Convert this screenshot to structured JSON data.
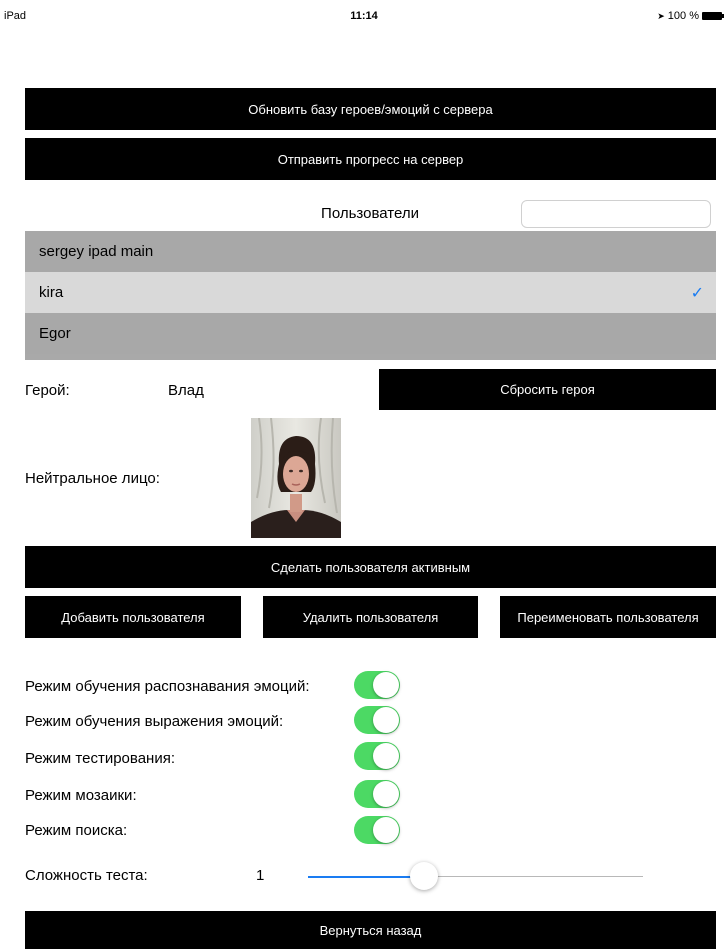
{
  "status_bar": {
    "carrier": "iPad",
    "time": "11:14",
    "location_icon": "location-arrow-icon",
    "battery_text": "100 %"
  },
  "buttons": {
    "update_db": "Обновить базу героев/эмоций с сервера",
    "send_progress": "Отправить прогресс на сервер",
    "reset_hero": "Сбросить героя",
    "make_active": "Сделать пользователя активным",
    "add_user": "Добавить пользователя",
    "delete_user": "Удалить пользователя",
    "rename_user": "Переименовать пользователя",
    "back": "Вернуться назад"
  },
  "users": {
    "title": "Пользователи",
    "search_value": "",
    "items": [
      {
        "name": "sergey ipad main",
        "selected": false
      },
      {
        "name": "kira",
        "selected": true
      },
      {
        "name": "Egor",
        "selected": false
      }
    ],
    "check_mark": "✓"
  },
  "hero": {
    "label": "Герой:",
    "value": "Влад"
  },
  "neutral_face": {
    "label": "Нейтральное лицо:"
  },
  "modes": [
    {
      "label": "Режим обучения распознавания эмоций:",
      "on": true
    },
    {
      "label": "Режим обучения выражения эмоций:",
      "on": true
    },
    {
      "label": "Режим тестирования:",
      "on": true
    },
    {
      "label": "Режим мозаики:",
      "on": true
    },
    {
      "label": "Режим поиска:",
      "on": true
    }
  ],
  "difficulty": {
    "label": "Сложность теста:",
    "value": "1"
  },
  "colors": {
    "toggle_on": "#4cd964",
    "accent": "#1a7cf2",
    "list_bg": "#a8a8a8",
    "list_selected": "#d9d9d9"
  }
}
